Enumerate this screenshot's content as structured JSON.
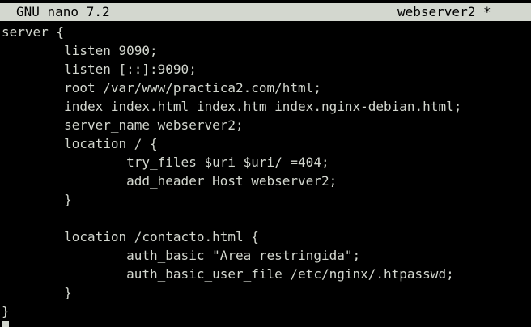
{
  "titlebar": {
    "app_version": "GNU nano 7.2",
    "file_name": "webserver2 *"
  },
  "lines": [
    "server {",
    "        listen 9090;",
    "        listen [::]:9090;",
    "        root /var/www/practica2.com/html;",
    "        index index.html index.htm index.nginx-debian.html;",
    "        server_name webserver2;",
    "        location / {",
    "                try_files $uri $uri/ =404;",
    "                add_header Host webserver2;",
    "        }",
    "",
    "        location /contacto.html {",
    "                auth_basic \"Area restringida\";",
    "                auth_basic_user_file /etc/nginx/.htpasswd;",
    "        }",
    "}"
  ],
  "colors": {
    "background": "#000000",
    "text": "#d3d7cf",
    "titlebar_bg": "#d3d7cf",
    "titlebar_text": "#000000"
  }
}
